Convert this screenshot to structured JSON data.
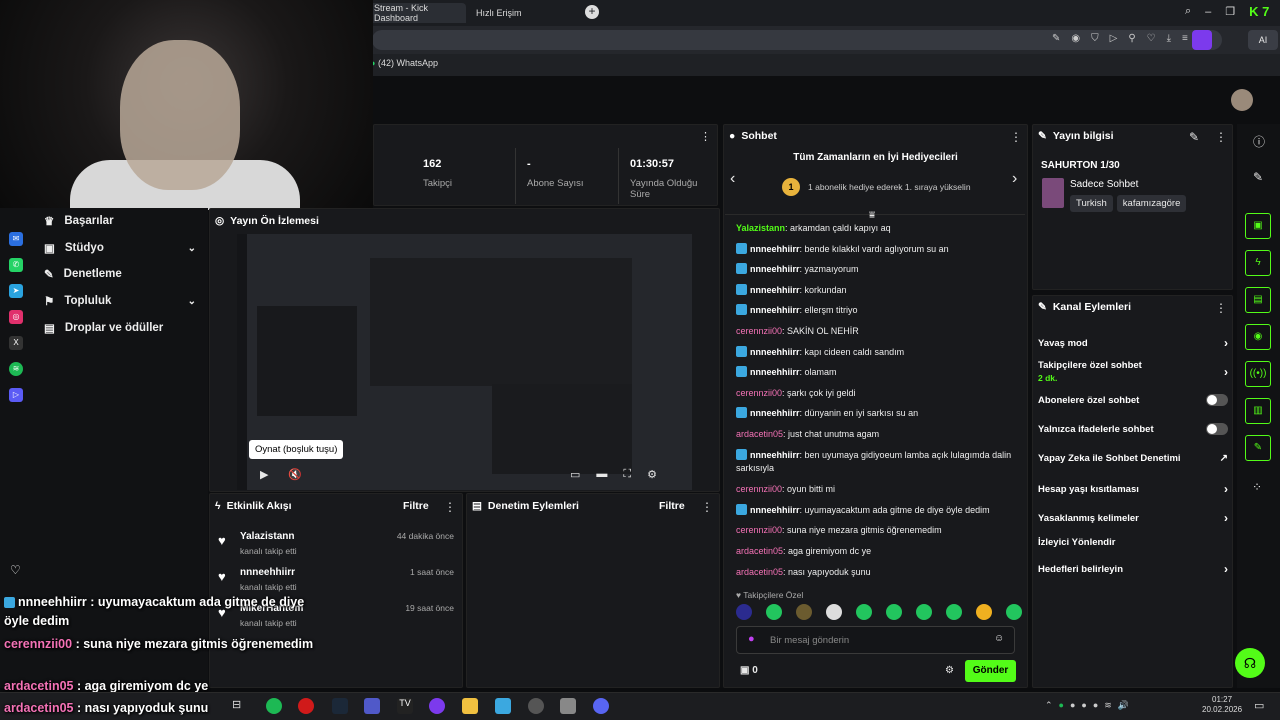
{
  "browser": {
    "tabs": [
      {
        "label": "Stream - Kick Dashboard"
      },
      {
        "label": "Hızlı Erişim"
      }
    ],
    "bookmark": "(42) WhatsApp",
    "ai": "AI",
    "kick": "7"
  },
  "stats": [
    {
      "value": "162",
      "label": "Takipçi"
    },
    {
      "value": "-",
      "label": "Abone Sayısı"
    },
    {
      "value": "01:30:57",
      "label": "Yayında Olduğu Süre"
    }
  ],
  "nav": [
    {
      "label": "Başarılar"
    },
    {
      "label": "Stüdyo"
    },
    {
      "label": "Denetleme"
    },
    {
      "label": "Topluluk"
    },
    {
      "label": "Droplar ve ödüller"
    }
  ],
  "preview": {
    "title": "Yayın Ön İzlemesi",
    "play_tooltip": "Oynat (boşluk tuşu)"
  },
  "activity": {
    "title": "Etkinlik Akışı",
    "filter": "Filtre",
    "events": [
      {
        "name": "Yalazistann",
        "action": "kanalı takip etti",
        "time": "44 dakika önce"
      },
      {
        "name": "nnneehhiirr",
        "action": "kanalı takip etti",
        "time": "1 saat önce"
      },
      {
        "name": "MikerHantom",
        "action": "kanalı takip etti",
        "time": "19 saat önce"
      }
    ]
  },
  "moderation": {
    "title": "Denetim Eylemleri",
    "filter": "Filtre"
  },
  "chat": {
    "title": "Sohbet",
    "top_title": "Tüm Zamanların en İyi Hediyecileri",
    "top_sub": "1 abonelik hediye ederek 1. sıraya yükselin",
    "top_rank": "1",
    "messages": [
      {
        "user": "Yalazistann",
        "text": ": arkamdan çaldı kapıyı aq",
        "style": "u1"
      },
      {
        "user": "nnneehhiirr",
        "text": ": bende kılakkıl vardı aglıyorum su an",
        "style": "u3"
      },
      {
        "user": "nnneehhiirr",
        "text": ": yazmaıyorum",
        "style": "u3"
      },
      {
        "user": "nnneehhiirr",
        "text": ": korkundan",
        "style": "u3"
      },
      {
        "user": "nnneehhiirr",
        "text": ": ellerşm titriyo",
        "style": "u3"
      },
      {
        "user": "cerennzii00",
        "text": ": SAKİN OL NEHİR",
        "style": "u2"
      },
      {
        "user": "nnneehhiirr",
        "text": ": kapı cideen caldı sandım",
        "style": "u3"
      },
      {
        "user": "nnneehhiirr",
        "text": ": olamam",
        "style": "u3"
      },
      {
        "user": "cerennzii00",
        "text": ": şarkı çok iyi geldi",
        "style": "u2"
      },
      {
        "user": "nnneehhiirr",
        "text": ": dünyanin en iyi sarkısı su an",
        "style": "u3"
      },
      {
        "user": "ardacetin05",
        "text": ": just chat unutma agam",
        "style": "u2"
      },
      {
        "user": "nnneehhiirr",
        "text": ": ben uyumaya gidiyoeum lamba açık lulagımda dalin sarkısıyla",
        "style": "u3"
      },
      {
        "user": "cerennzii00",
        "text": ": oyun bitti mi",
        "style": "u2"
      },
      {
        "user": "nnneehhiirr",
        "text": ": uyumayacaktum ada gitme de diye öyle dedim",
        "style": "u3"
      },
      {
        "user": "cerennzii00",
        "text": ": suna niye mezara gitmis öğrenemedim",
        "style": "u2"
      },
      {
        "user": "ardacetin05",
        "text": ": aga giremiyom dc ye",
        "style": "u2"
      },
      {
        "user": "ardacetin05",
        "text": ": nası yapıyoduk şunu",
        "style": "u2"
      }
    ],
    "followers_only": "Takipçilere Özel",
    "input_placeholder": "Bir mesaj gönderin",
    "points": "0",
    "send": "Gönder"
  },
  "stream_info": {
    "title": "Yayın bilgisi",
    "stream_title": "SAHURTON 1/30",
    "category": "Sadece Sohbet",
    "tags": [
      "Turkish",
      "kafamızagöre"
    ]
  },
  "channel_actions": {
    "title": "Kanal Eylemleri",
    "items": [
      {
        "label": "Yavaş mod",
        "sub": ""
      },
      {
        "label": "Takipçilere özel sohbet",
        "sub": "2 dk."
      },
      {
        "label": "Abonelere özel sohbet",
        "sub": ""
      },
      {
        "label": "Yalnızca ifadelerle sohbet",
        "sub": ""
      },
      {
        "label": "Yapay Zeka ile Sohbet Denetimi",
        "sub": ""
      },
      {
        "label": "Hesap yaşı kısıtlaması",
        "sub": ""
      },
      {
        "label": "Yasaklanmış kelimeler",
        "sub": ""
      },
      {
        "label": "İzleyici Yönlendir",
        "sub": ""
      },
      {
        "label": "Hedefleri belirleyin",
        "sub": ""
      }
    ]
  },
  "overlay": [
    {
      "user": "nnneehhiirr",
      "text": " : uyumayacaktum ada gitme de diye"
    },
    {
      "user": "",
      "text": "öyle dedim"
    },
    {
      "user": "cerennzii00",
      "text": " : suna niye mezara gitmis öğrenemedim"
    },
    {
      "user": "ardacetin05",
      "text": " : aga giremiyom dc ye"
    },
    {
      "user": "ardacetin05",
      "text": " : nası yapıyoduk şunu"
    }
  ],
  "clock": {
    "time": "01:27",
    "date": "20.02.2026"
  }
}
